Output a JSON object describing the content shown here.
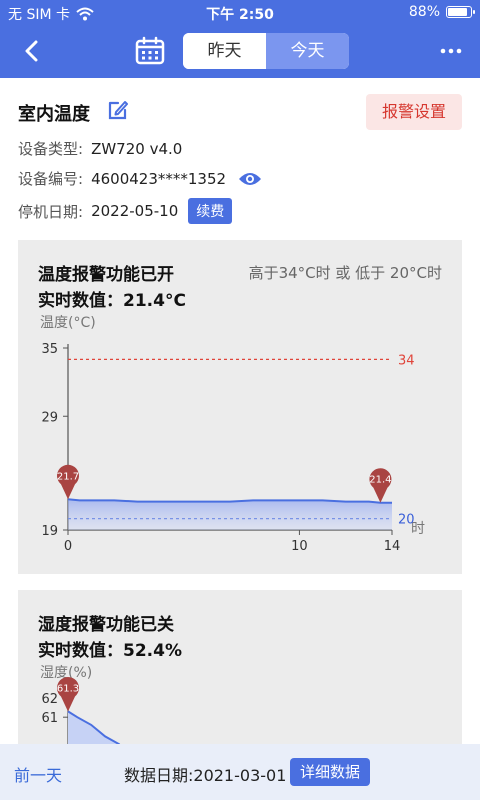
{
  "status_bar": {
    "carrier": "无 SIM 卡",
    "time": "下午 2:50",
    "battery": "88%",
    "battery_level": 0.88
  },
  "nav": {
    "tabs": [
      {
        "label": "昨天",
        "active": false
      },
      {
        "label": "今天",
        "active": true
      }
    ]
  },
  "device": {
    "name": "室内温度",
    "alarm_button": "报警设置",
    "type_label": "设备类型:",
    "type_value": "ZW720 v4.0",
    "id_label": "设备编号:",
    "id_value": "4600423****1352",
    "stop_label": "停机日期:",
    "stop_value": "2022-05-10",
    "renew_button": "续费"
  },
  "temperature_panel": {
    "title": "温度报警功能已开",
    "range_text": "高于34°C时 或 低于 20°C时",
    "value_text": "实时数值：21.4°C",
    "chart_data": {
      "type": "line",
      "ylabel": "温度(°C)",
      "xlabel": "时",
      "ylim": [
        19,
        35
      ],
      "xlim": [
        0,
        14
      ],
      "y_ticks": [
        "35",
        "29",
        "19"
      ],
      "x_ticks": [
        "0",
        "10",
        "14"
      ],
      "upper_threshold": 34,
      "lower_threshold": 20,
      "upper_label": "34",
      "lower_label": "20",
      "points": [
        [
          0,
          21.7
        ],
        [
          0.5,
          21.6
        ],
        [
          1,
          21.6
        ],
        [
          2,
          21.6
        ],
        [
          3,
          21.5
        ],
        [
          4,
          21.5
        ],
        [
          5,
          21.5
        ],
        [
          6,
          21.5
        ],
        [
          7,
          21.5
        ],
        [
          8,
          21.6
        ],
        [
          9,
          21.6
        ],
        [
          10,
          21.6
        ],
        [
          11,
          21.6
        ],
        [
          12,
          21.5
        ],
        [
          13,
          21.5
        ],
        [
          13.5,
          21.4
        ],
        [
          14,
          21.4
        ]
      ],
      "markers": [
        {
          "x": 0,
          "y": 21.7,
          "label": "21.7"
        },
        {
          "x": 13.5,
          "y": 21.4,
          "label": "21.4"
        }
      ],
      "colors": {
        "line": "#4a6fe0",
        "upper": "#e0443a",
        "lower": "#3a5fd8",
        "marker": "#a94442"
      }
    }
  },
  "humidity_panel": {
    "title": "湿度报警功能已关",
    "value_text": "实时数值：52.4%",
    "chart_data": {
      "type": "line",
      "ylabel": "湿度(%)",
      "y_ticks": [
        "62",
        "61"
      ],
      "ylim": [
        52,
        62
      ],
      "points": [
        [
          0,
          61.3
        ],
        [
          0.4,
          61.0
        ],
        [
          1.0,
          60.6
        ],
        [
          1.6,
          60.0
        ],
        [
          2.2,
          59.6
        ],
        [
          2.6,
          59.0
        ],
        [
          3.0,
          58.6
        ]
      ],
      "markers": [
        {
          "x": 0,
          "y": 61.3,
          "label": "61.3"
        }
      ],
      "colors": {
        "line": "#4a6fe0",
        "marker": "#a94442"
      }
    }
  },
  "bottom_bar": {
    "prev_day": "前一天",
    "data_date": "数据日期:2021-03-01",
    "detail_button": "详细数据"
  }
}
